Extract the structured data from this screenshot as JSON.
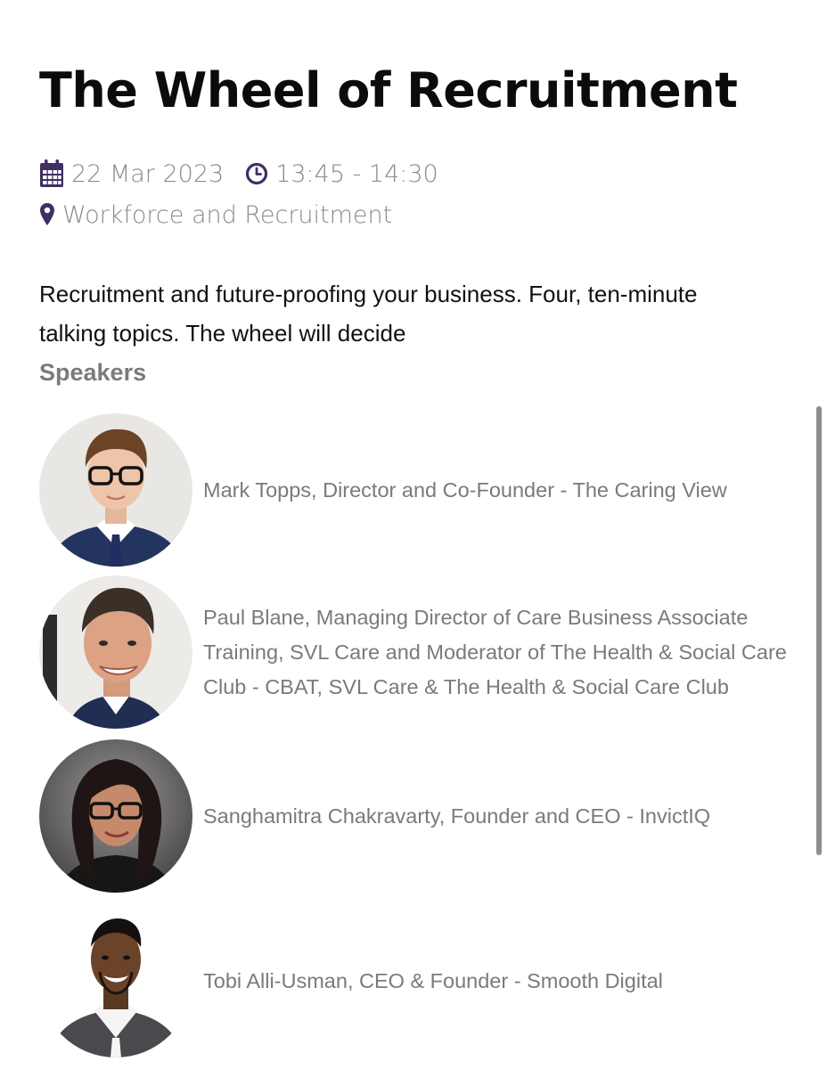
{
  "event": {
    "title": "The Wheel of Recruitment",
    "date": "22 Mar 2023",
    "time": "13:45 - 14:30",
    "location": "Workforce and Recruitment",
    "description": "Recruitment and future-proofing your business. Four, ten-minute talking topics. The wheel will decide"
  },
  "icons": {
    "date": "calendar-icon",
    "time": "clock-icon",
    "location": "map-pin-icon",
    "accent_color": "#3f2f63"
  },
  "speakers_heading": "Speakers",
  "speakers": [
    {
      "text": "Mark Topps, Director and Co-Founder - The Caring View"
    },
    {
      "text": "Paul Blane, Managing Director of Care Business Associate Training, SVL Care and Moderator of The Health & Social Care Club - CBAT, SVL Care & The Health & Social Care Club"
    },
    {
      "text": "Sanghamitra Chakravarty, Founder and CEO - InvictIQ"
    },
    {
      "text": "Tobi Alli-Usman, CEO & Founder - Smooth Digital"
    }
  ]
}
